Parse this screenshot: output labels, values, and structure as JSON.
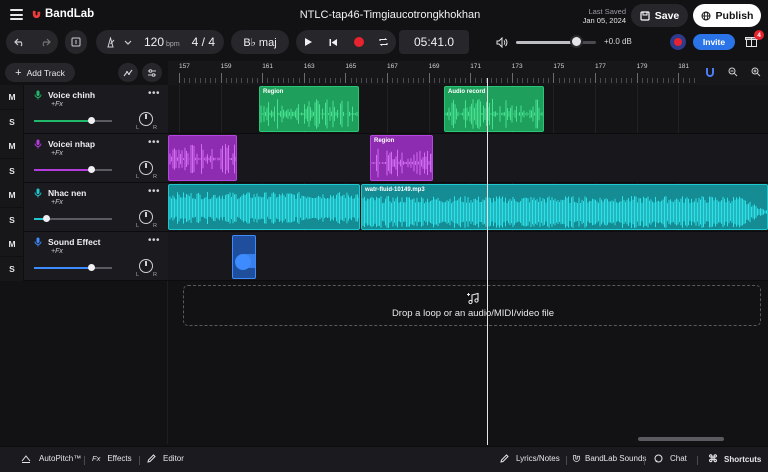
{
  "topbar": {
    "brand": "BandLab",
    "project_title": "NTLC-tap46-Timgiaucotrongkhokhan",
    "last_saved_label": "Last Saved",
    "last_saved_date": "Jan 05, 2024",
    "save_label": "Save",
    "publish_label": "Publish"
  },
  "toolbar": {
    "tempo": "120",
    "tempo_unit": "bpm",
    "time_signature": "4 / 4",
    "key": "B♭ maj",
    "time": "05:41.0",
    "volume_db": "+0.0 dB",
    "volume_level": 0.75,
    "invite_label": "Invite",
    "gift_badge": "4"
  },
  "sidebar": {
    "add_track_label": "Add Track"
  },
  "ruler": {
    "bars": [
      "157",
      "159",
      "161",
      "163",
      "165",
      "167",
      "169",
      "171",
      "173",
      "175",
      "177",
      "179",
      "181"
    ]
  },
  "tracks": [
    {
      "name": "Voice chinh",
      "fx": "+Fx",
      "mute": "M",
      "solo": "S",
      "color": "#20b86a",
      "volume": 0.74,
      "pan_l": "L",
      "pan_r": "R"
    },
    {
      "name": "Voicei nhap",
      "fx": "+Fx",
      "mute": "M",
      "solo": "S",
      "color": "#b43cdc",
      "volume": 0.74,
      "pan_l": "L",
      "pan_r": "R"
    },
    {
      "name": "Nhac nen",
      "fx": "+Fx",
      "mute": "M",
      "solo": "S",
      "color": "#1fc7cf",
      "volume": 0.16,
      "pan_l": "L",
      "pan_r": "R"
    },
    {
      "name": "Sound Effect",
      "fx": "+Fx",
      "mute": "M",
      "solo": "S",
      "color": "#3d8bff",
      "volume": 0.74,
      "pan_l": "L",
      "pan_r": "R"
    }
  ],
  "regions": {
    "voice_region_1": "Region",
    "voice_region_2": "Audio record",
    "voicei_region": "Region",
    "music_region": "watr-fluid-10149.mp3"
  },
  "drop_zone": {
    "text": "Drop a loop or an audio/MIDI/video file"
  },
  "bottombar": {
    "autopitch": "AutoPitch™",
    "effects": "Effects",
    "editor": "Editor",
    "lyrics": "Lyrics/Notes",
    "sounds": "BandLab Sounds",
    "chat": "Chat",
    "shortcuts": "Shortcuts"
  }
}
